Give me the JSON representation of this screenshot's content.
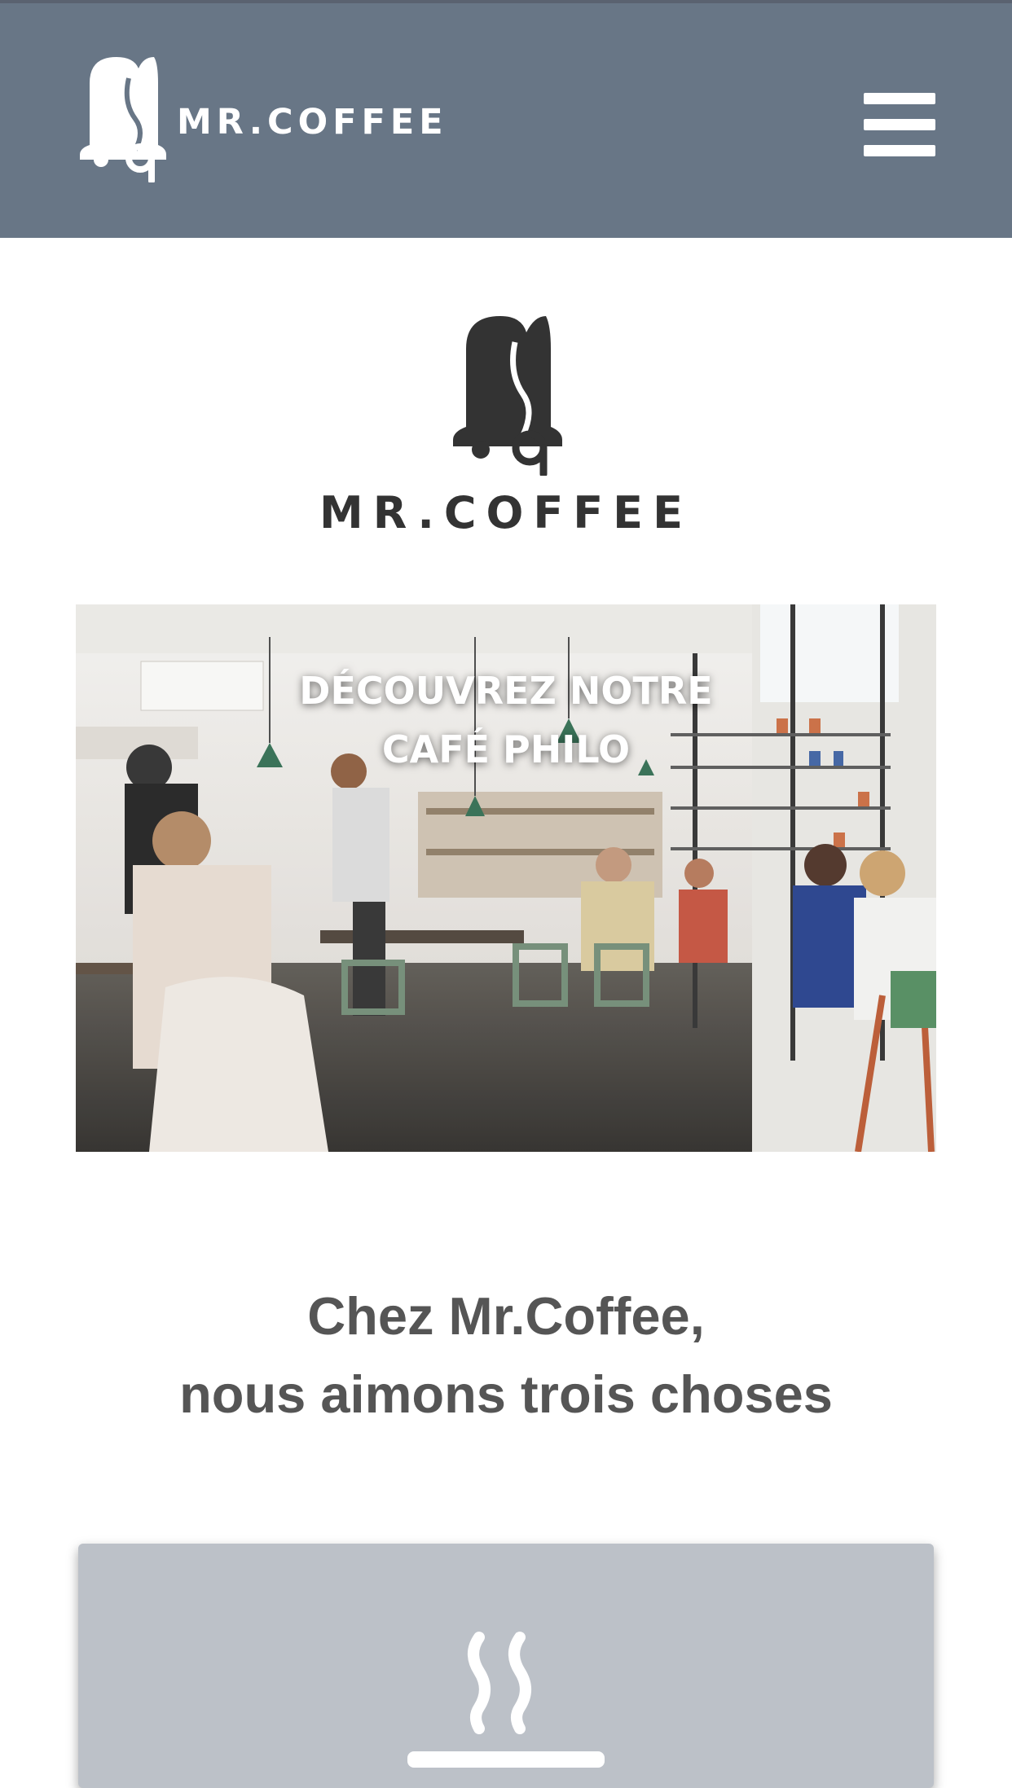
{
  "header": {
    "brand": "MR.COFFEE",
    "menu_icon": "hamburger-menu-icon",
    "background": "#687686"
  },
  "intro": {
    "brand": "MR.COFFEE",
    "logo_icon": "bell-logo-icon"
  },
  "hero": {
    "title_line1": "DÉCOUVREZ NOTRE",
    "title_line2": "CAFÉ PHILO",
    "image": "cafe-interior-photo"
  },
  "tagline": {
    "line1": "Chez Mr.Coffee,",
    "line2": "nous aimons trois choses"
  },
  "card": {
    "icon": "steaming-cup-icon",
    "background": "#bcc1c8"
  }
}
